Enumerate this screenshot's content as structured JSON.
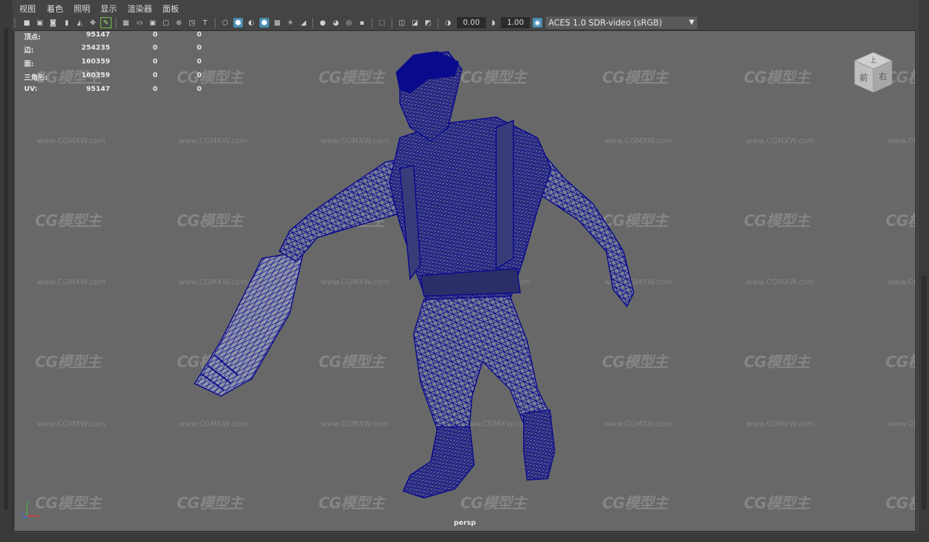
{
  "menu": [
    "视图",
    "着色",
    "照明",
    "显示",
    "渲染器",
    "面板"
  ],
  "toolbar": {
    "exposure": "0.00",
    "gamma": "1.00",
    "color_space": "ACES 1.0 SDR-video (sRGB)"
  },
  "hud": {
    "rows": [
      {
        "label": "顶点:",
        "v1": "95147",
        "v2": "0",
        "v3": "0"
      },
      {
        "label": "边:",
        "v1": "254235",
        "v2": "0",
        "v3": "0"
      },
      {
        "label": "面:",
        "v1": "160359",
        "v2": "0",
        "v3": "0"
      },
      {
        "label": "三角形:",
        "v1": "160359",
        "v2": "0",
        "v3": "0"
      },
      {
        "label": "UV:",
        "v1": "95147",
        "v2": "0",
        "v3": "0"
      }
    ]
  },
  "viewcube": {
    "top": "上",
    "front": "前",
    "right": "右"
  },
  "camera": "persp",
  "watermark": {
    "logo": "CG模型主",
    "url": "www.CGMXW.com"
  },
  "axis": {
    "x": "x",
    "y": "y",
    "z": "z"
  },
  "colors": {
    "wire": "#0a0a8c",
    "viewport_bg": "#686868"
  }
}
